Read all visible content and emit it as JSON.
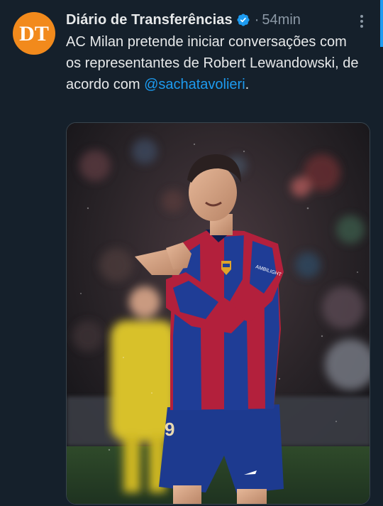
{
  "tweet": {
    "author": {
      "display_name": "Diário de Transferências",
      "avatar_text": "DT",
      "verified": true
    },
    "separator": "·",
    "time": "54min",
    "text_prefix": "AC Milan pretende iniciar conversações com os representantes de Robert Lewandowski, de acordo com ",
    "mention": "@sachatavolieri",
    "text_suffix": ".",
    "media": {
      "jersey_number": "9",
      "jersey_sponsor": "AMBILIGHT"
    }
  },
  "colors": {
    "background": "#15202b",
    "accent": "#1d9bf0",
    "avatar": "#f28a1c"
  },
  "icons": {
    "verified": "verified-badge-icon",
    "more": "more-vertical-icon"
  }
}
